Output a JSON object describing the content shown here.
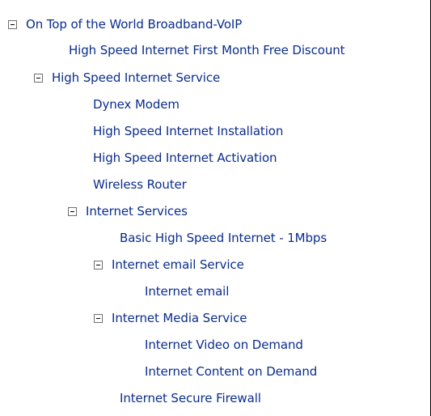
{
  "colors": {
    "link": "#0a2d8c",
    "toggle_border": "#6f6f6f",
    "background": "#ffffff"
  },
  "icons": {
    "toggle": "minus-box-icon"
  },
  "tree": [
    {
      "label": "On Top of the World Broadband-VoIP",
      "expanded": true
    },
    {
      "label": "High Speed Internet First Month Free Discount"
    },
    {
      "label": "High Speed Internet Service",
      "expanded": true
    },
    {
      "label": "Dynex Modem"
    },
    {
      "label": "High Speed Internet Installation"
    },
    {
      "label": "High Speed Internet Activation"
    },
    {
      "label": "Wireless Router"
    },
    {
      "label": "Internet Services",
      "expanded": true
    },
    {
      "label": "Basic High Speed Internet - 1Mbps"
    },
    {
      "label": "Internet email Service",
      "expanded": true
    },
    {
      "label": "Internet email"
    },
    {
      "label": "Internet Media Service",
      "expanded": true
    },
    {
      "label": "Internet Video on Demand"
    },
    {
      "label": "Internet Content on Demand"
    },
    {
      "label": "Internet Secure Firewall"
    }
  ]
}
